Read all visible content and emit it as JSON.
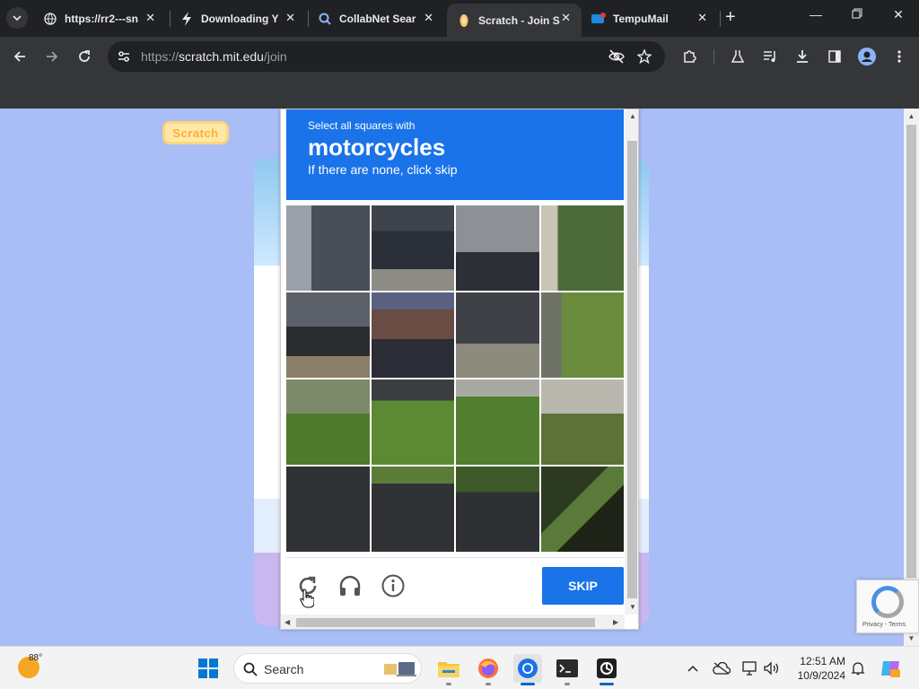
{
  "browser": {
    "tabs": [
      {
        "title": "https://rr2---sn",
        "icon": "globe-icon",
        "active": false
      },
      {
        "title": "Downloading Y",
        "icon": "lightning-icon",
        "active": false
      },
      {
        "title": "CollabNet Sear",
        "icon": "search-icon",
        "active": false
      },
      {
        "title": "Scratch - Join S",
        "icon": "scratch-cat-icon",
        "active": true
      },
      {
        "title": "TempuMail",
        "icon": "tempumail-icon",
        "active": false
      }
    ],
    "address": {
      "scheme": "https://",
      "host": "scratch.mit.edu",
      "path": "/join"
    }
  },
  "page": {
    "logo_text": "Scratch"
  },
  "captcha": {
    "instruction_line1": "Select all squares with",
    "target": "motorcycles",
    "instruction_line2": "If there are none, click skip",
    "skip_label": "SKIP",
    "rows": 4,
    "cols": 4,
    "badge_links": "Privacy - Terms"
  },
  "taskbar": {
    "weather_temp": "88°",
    "search_label": "Search",
    "time": "12:51 AM",
    "date": "10/9/2024"
  },
  "colors": {
    "captcha_blue": "#1a73e8",
    "page_background": "#a9bdf6",
    "chrome_dark": "#202124"
  }
}
